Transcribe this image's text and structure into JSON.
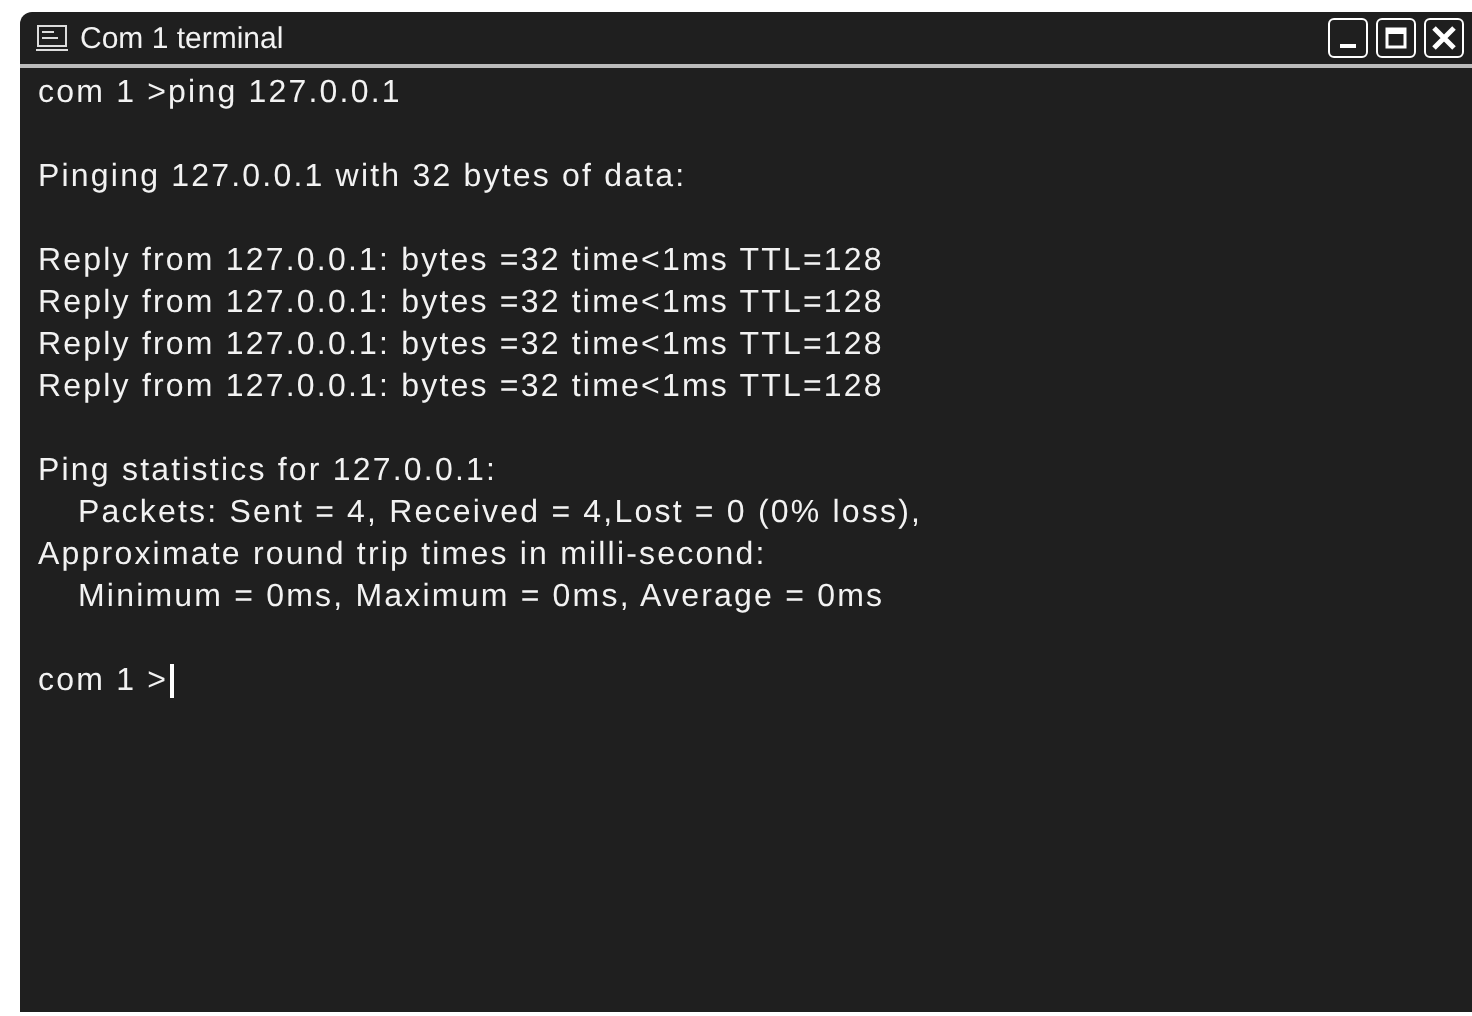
{
  "window": {
    "title": "Com 1 terminal"
  },
  "output": [
    [
      {
        "text": "com 1 >ping 127.0.0.1",
        "indented": false
      }
    ],
    [
      {
        "text": "Pinging 127.0.0.1 with 32 bytes of data:",
        "indented": false
      }
    ],
    [
      {
        "text": "Reply from 127.0.0.1: bytes =32 time<1ms TTL=128",
        "indented": false
      },
      {
        "text": "Reply from 127.0.0.1: bytes =32 time<1ms TTL=128",
        "indented": false
      },
      {
        "text": "Reply from 127.0.0.1: bytes =32 time<1ms TTL=128",
        "indented": false
      },
      {
        "text": "Reply from 127.0.0.1: bytes =32 time<1ms TTL=128",
        "indented": false
      }
    ],
    [
      {
        "text": "Ping statistics for 127.0.0.1:",
        "indented": false
      },
      {
        "text": "Packets: Sent = 4, Received = 4,Lost = 0 (0% loss),",
        "indented": true
      },
      {
        "text": "Approximate round trip times in milli-second:",
        "indented": false
      },
      {
        "text": "Minimum = 0ms, Maximum = 0ms, Average = 0ms",
        "indented": true
      }
    ]
  ],
  "prompt": {
    "text": "com 1 >",
    "cursor": true
  }
}
